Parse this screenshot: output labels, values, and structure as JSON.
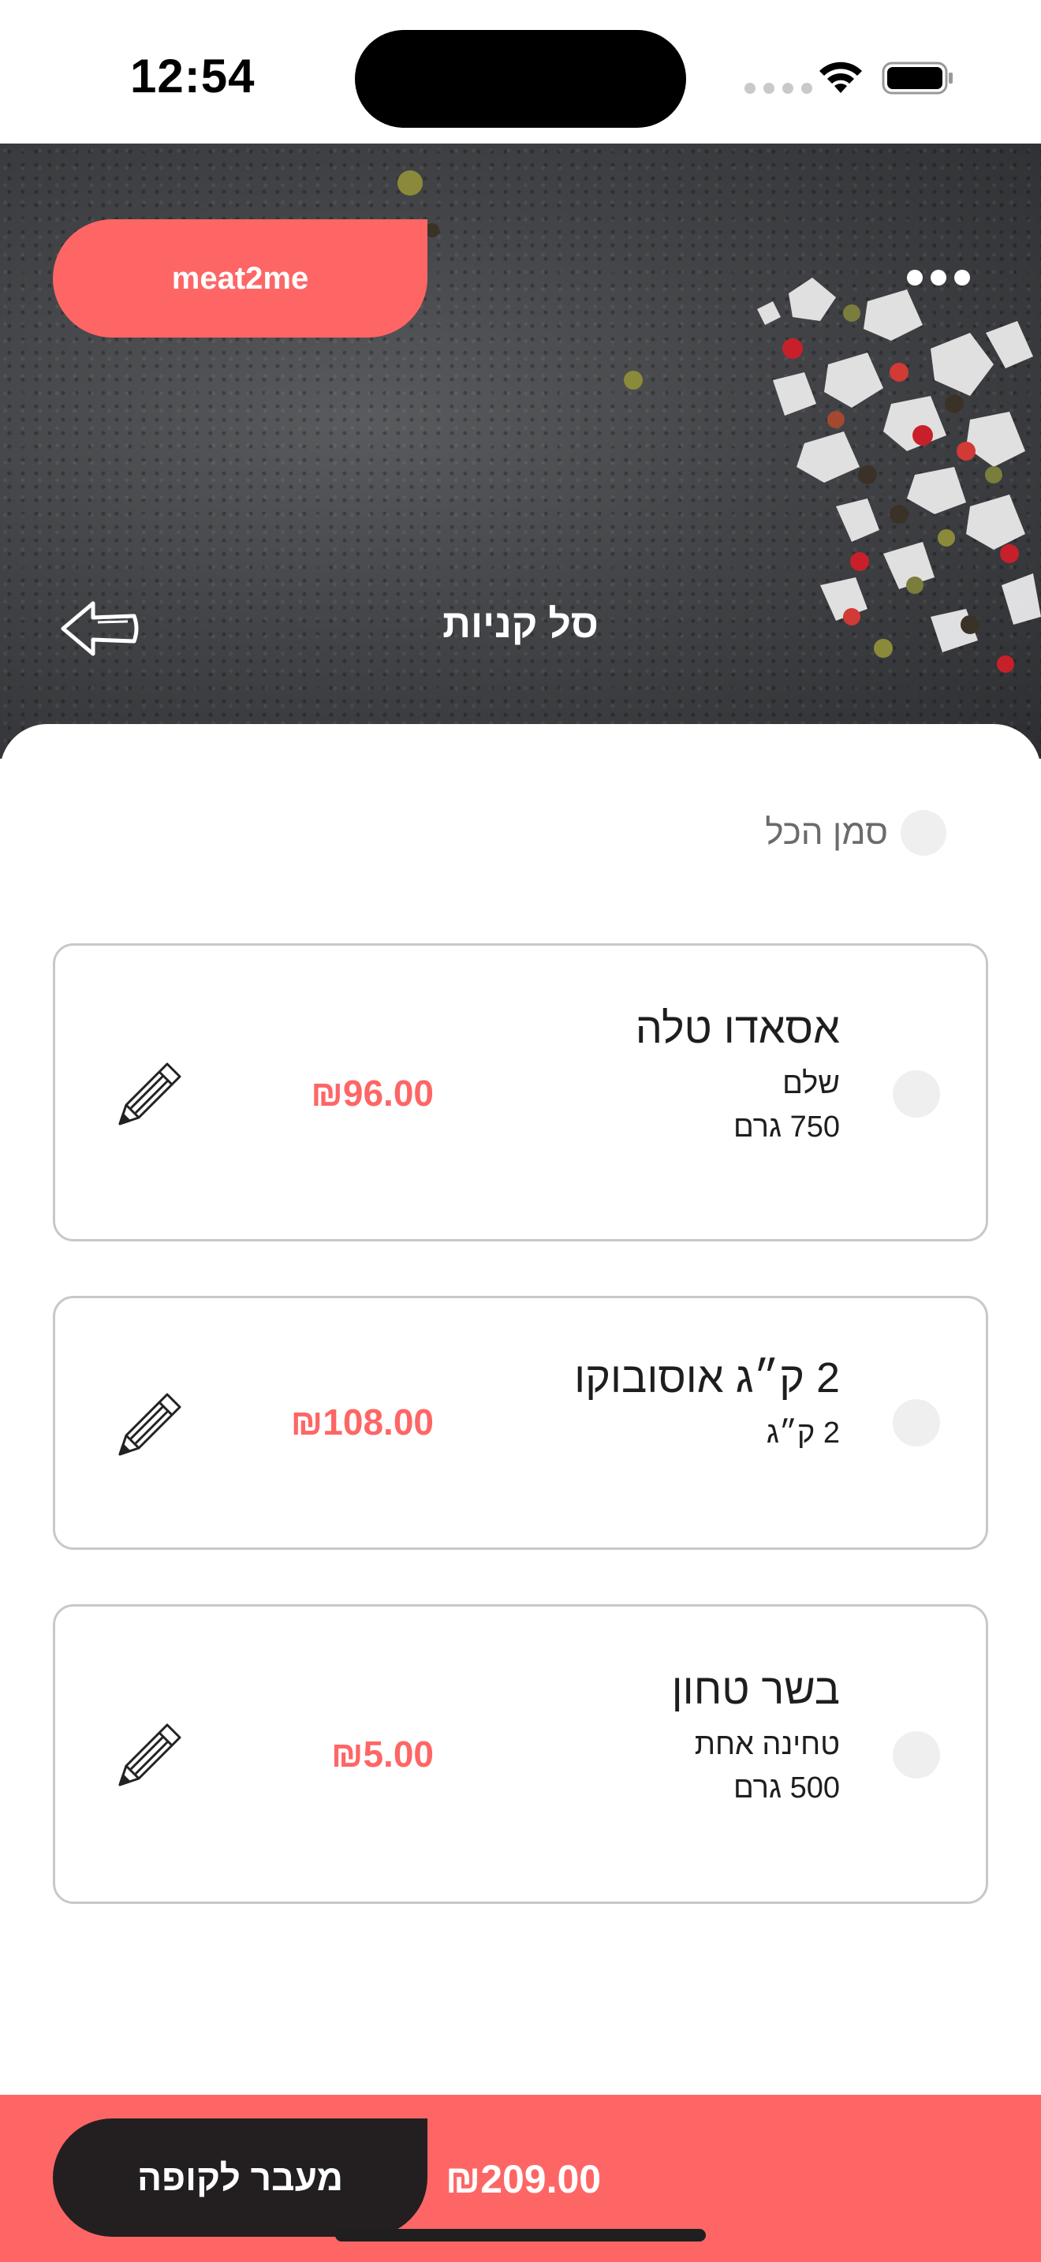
{
  "status_bar": {
    "time": "12:54"
  },
  "header": {
    "brand": "meat2me",
    "title": "סל קניות"
  },
  "select_all": {
    "label": "סמן הכל"
  },
  "cart": {
    "items": [
      {
        "title": "אסאדו טלה",
        "line1": "שלם",
        "line2": "750 גרם",
        "price": "₪96.00"
      },
      {
        "title": "2 ק״ג אוסובוקו",
        "line1": "2 ק״ג",
        "line2": "",
        "price": "₪108.00"
      },
      {
        "title": "בשר טחון",
        "line1": "טחינה אחת",
        "line2": "500 גרם",
        "price": "₪5.00"
      }
    ]
  },
  "footer": {
    "checkout_label": "מעבר לקופה",
    "total": "₪209.00"
  },
  "colors": {
    "accent": "#fe6666",
    "dark_button": "#231f20",
    "card_border": "#c8c8c8"
  },
  "icons": [
    "wifi-icon",
    "battery-icon",
    "more-icon",
    "back-arrow-icon",
    "pencil-icon"
  ]
}
